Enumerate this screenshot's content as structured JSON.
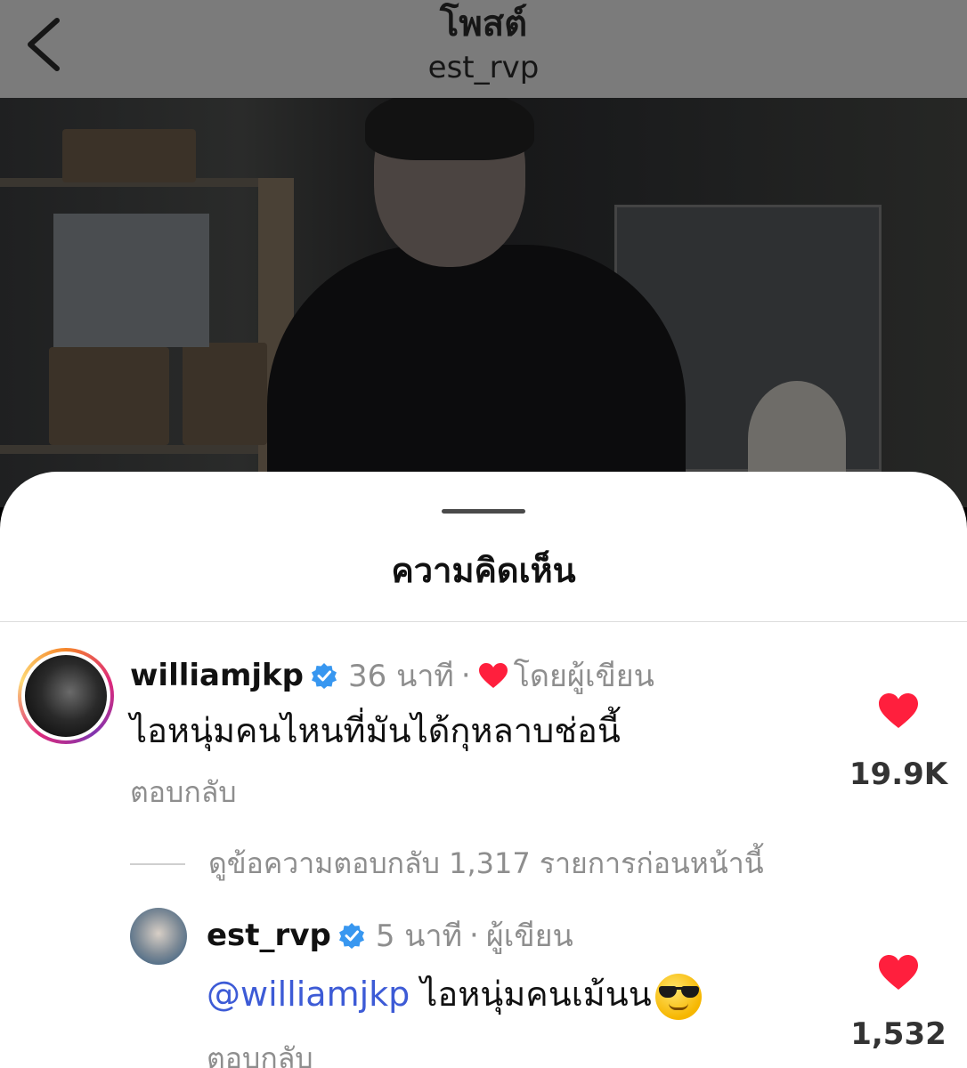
{
  "header": {
    "title": "โพสต์",
    "subtitle": "est_rvp",
    "back_icon": "chevron-left-icon"
  },
  "colors": {
    "overlay": "#7b7b7b",
    "heart": "#ff1f3d",
    "verified": "#3897f0",
    "mention": "#3d5bd6",
    "muted_text": "#8e8e8e"
  },
  "sheet": {
    "title": "ความคิดเห็น"
  },
  "comments": [
    {
      "username": "williamjkp",
      "verified": true,
      "time": "36 นาที",
      "separator": "·",
      "liked_by_author_label": "โดยผู้เขียน",
      "text": "ไอหนุ่มคนไหนที่มันได้กุหลาบช่อนี้",
      "reply_label": "ตอบกลับ",
      "like_count": "19.9K",
      "view_replies_label": "ดูข้อความตอบกลับ 1,317 รายการก่อนหน้านี้"
    },
    {
      "username": "est_rvp",
      "verified": true,
      "time": "5 นาที",
      "separator": "·",
      "author_label": "ผู้เขียน",
      "mention": "@williamjkp",
      "text": "ไอหนุ่มคนเม้นน",
      "emoji": "smiling-face-with-sunglasses",
      "reply_label": "ตอบกลับ",
      "like_count": "1,532"
    }
  ]
}
